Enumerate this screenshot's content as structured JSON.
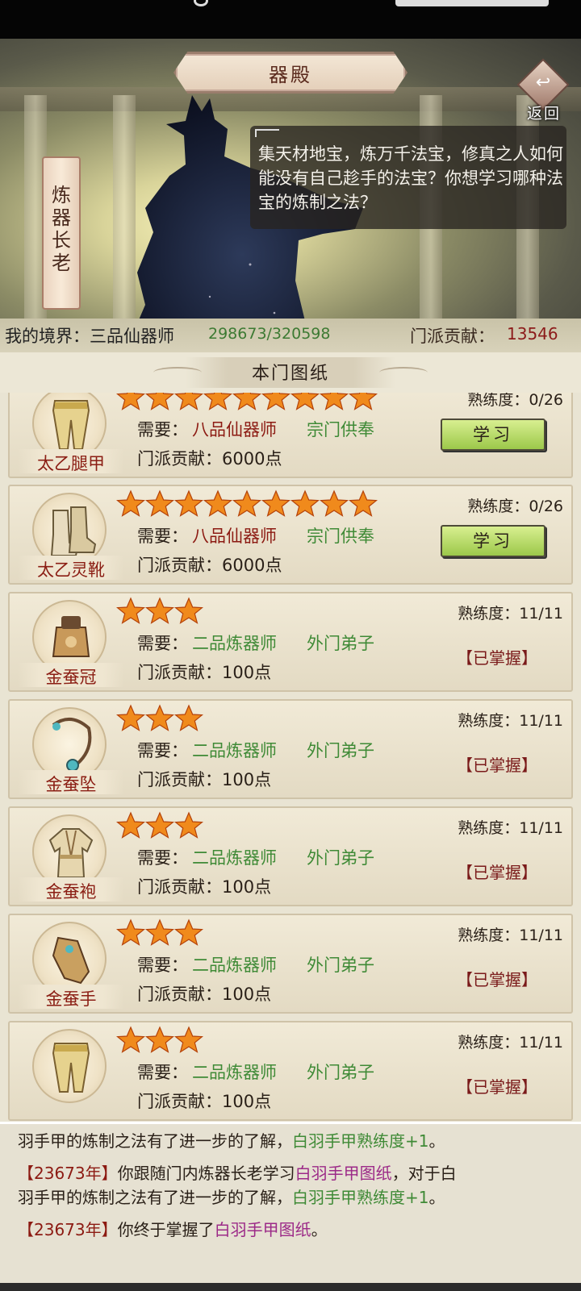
{
  "header": {
    "title": "器殿",
    "back_label": "返回"
  },
  "npc": {
    "name": "炼器长老",
    "dialogue": "集天材地宝，炼万千法宝，修真之人如何能没有自己趁手的法宝？你想学习哪种法宝的炼制之法？"
  },
  "status": {
    "realm_label": "我的境界：三品仙器师",
    "exp": "298673/320598",
    "contribution_label": "门派贡献：",
    "contribution": "13546"
  },
  "panel": {
    "title": "本门图纸"
  },
  "blueprints": [
    {
      "name": "太乙腿甲",
      "stars": 9,
      "prof_label": "熟练度：",
      "prof": "0/26",
      "req_label": "需要：",
      "req_realm": "八品仙器师",
      "req_rank": "宗门供奉",
      "cost_label": "门派贡献：6000点",
      "state": "learn",
      "button": "学习",
      "icon": "leg-armor-icon"
    },
    {
      "name": "太乙灵靴",
      "stars": 9,
      "prof_label": "熟练度：",
      "prof": "0/26",
      "req_label": "需要：",
      "req_realm": "八品仙器师",
      "req_rank": "宗门供奉",
      "cost_label": "门派贡献：6000点",
      "state": "learn",
      "button": "学习",
      "icon": "boots-icon"
    },
    {
      "name": "金蚕冠",
      "stars": 3,
      "prof_label": "熟练度：",
      "prof": "11/11",
      "req_label": "需要：",
      "req_realm": "二品炼器师",
      "req_rank": "外门弟子",
      "cost_label": "门派贡献：100点",
      "state": "mastered",
      "button": "【已掌握】",
      "icon": "crown-icon"
    },
    {
      "name": "金蚕坠",
      "stars": 3,
      "prof_label": "熟练度：",
      "prof": "11/11",
      "req_label": "需要：",
      "req_realm": "二品炼器师",
      "req_rank": "外门弟子",
      "cost_label": "门派贡献：100点",
      "state": "mastered",
      "button": "【已掌握】",
      "icon": "pendant-icon"
    },
    {
      "name": "金蚕袍",
      "stars": 3,
      "prof_label": "熟练度：",
      "prof": "11/11",
      "req_label": "需要：",
      "req_realm": "二品炼器师",
      "req_rank": "外门弟子",
      "cost_label": "门派贡献：100点",
      "state": "mastered",
      "button": "【已掌握】",
      "icon": "robe-icon"
    },
    {
      "name": "金蚕手",
      "stars": 3,
      "prof_label": "熟练度：",
      "prof": "11/11",
      "req_label": "需要：",
      "req_realm": "二品炼器师",
      "req_rank": "外门弟子",
      "cost_label": "门派贡献：100点",
      "state": "mastered",
      "button": "【已掌握】",
      "icon": "gauntlet-icon"
    },
    {
      "name": "",
      "stars": 3,
      "prof_label": "熟练度：",
      "prof": "11/11",
      "req_label": "需要：",
      "req_realm": "二品炼器师",
      "req_rank": "外门弟子",
      "cost_label": "门派贡献：100点",
      "state": "mastered",
      "button": "【已掌握】",
      "icon": "leg-armor-icon"
    }
  ],
  "log": {
    "line1": {
      "a": "羽手甲的炼制之法有了进一步的了解，",
      "b": "白羽手甲熟练度+1",
      "c": "。"
    },
    "line2": {
      "year": "【23673年】",
      "a": "你跟随门内炼器长老学习",
      "b": "白羽手甲图纸",
      "c": "，对于白"
    },
    "line3": {
      "a": "羽手甲的炼制之法有了进一步的了解，",
      "b": "白羽手甲熟练度+1",
      "c": "。"
    },
    "line4": {
      "year": "【23673年】",
      "a": "你终于掌握了",
      "b": "白羽手甲图纸",
      "c": "。"
    }
  },
  "colors": {
    "req_high": "#8c1a12",
    "req_low": "#3f8a36",
    "star": "#f08a1c",
    "learn_button": "#b7dc6a"
  }
}
